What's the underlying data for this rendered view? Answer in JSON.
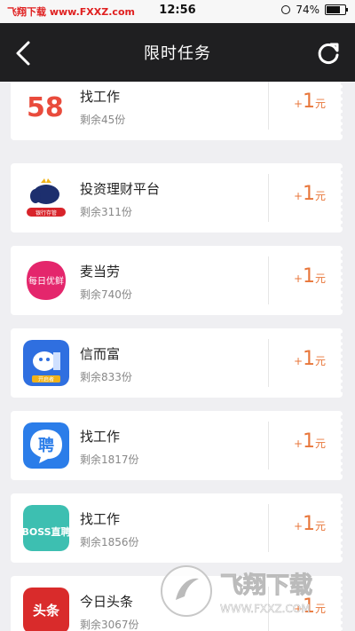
{
  "status_bar": {
    "left_text": "飞翔下载 www.FXXZ.com",
    "time": "12:56",
    "battery_pct": "74%",
    "battery_level": 0.74
  },
  "nav": {
    "title": "限时任务"
  },
  "tasks": [
    {
      "name": "找工作",
      "remaining": "剩余45份",
      "plus": "+",
      "reward": "1",
      "unit": "元",
      "logo_text": "58"
    },
    {
      "name": "投资理财平台",
      "remaining": "剩余311份",
      "plus": "+",
      "reward": "1",
      "unit": "元",
      "logo_text": "银行存管"
    },
    {
      "name": "麦当劳",
      "remaining": "剩余740份",
      "plus": "+",
      "reward": "1",
      "unit": "元",
      "logo_text": "每日优鲜"
    },
    {
      "name": "信而富",
      "remaining": "剩余833份",
      "plus": "+",
      "reward": "1",
      "unit": "元",
      "logo_text": "开启者"
    },
    {
      "name": "找工作",
      "remaining": "剩余1817份",
      "plus": "+",
      "reward": "1",
      "unit": "元",
      "logo_text": "聘"
    },
    {
      "name": "找工作",
      "remaining": "剩余1856份",
      "plus": "+",
      "reward": "1",
      "unit": "元",
      "logo_text": "BOSS直聘"
    },
    {
      "name": "今日头条",
      "remaining": "剩余3067份",
      "plus": "+",
      "reward": "1",
      "unit": "元",
      "logo_text": "头条"
    }
  ],
  "watermark": {
    "text": "飞翔下载",
    "url": "WWW.FXXZ.COM"
  }
}
